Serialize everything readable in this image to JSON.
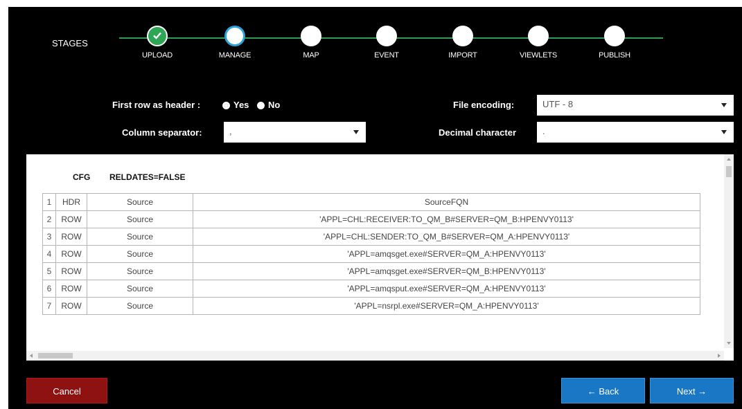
{
  "stages": {
    "label": "STAGES",
    "items": [
      {
        "name": "UPLOAD",
        "state": "done"
      },
      {
        "name": "MANAGE",
        "state": "active"
      },
      {
        "name": "MAP",
        "state": "pending"
      },
      {
        "name": "EVENT",
        "state": "pending"
      },
      {
        "name": "IMPORT",
        "state": "pending"
      },
      {
        "name": "VIEWLETS",
        "state": "pending"
      },
      {
        "name": "PUBLISH",
        "state": "pending"
      }
    ]
  },
  "options": {
    "header_label": "First row as header :",
    "header_yes": "Yes",
    "header_no": "No",
    "header_selected": "Yes",
    "encoding_label": "File encoding:",
    "encoding_value": "UTF - 8",
    "separator_label": "Column separator:",
    "separator_value": ",",
    "decimal_label": "Decimal character",
    "decimal_value": "."
  },
  "table": {
    "cfg_label": "CFG",
    "cfg_value": "RELDATES=FALSE",
    "rows": [
      {
        "num": "1",
        "type": "HDR",
        "source": "Source",
        "fqn": "SourceFQN"
      },
      {
        "num": "2",
        "type": "ROW",
        "source": "Source",
        "fqn": "'APPL=CHL:RECEIVER:TO_QM_B#SERVER=QM_B:HPENVY0113'"
      },
      {
        "num": "3",
        "type": "ROW",
        "source": "Source",
        "fqn": "'APPL=CHL:SENDER:TO_QM_B#SERVER=QM_A:HPENVY0113'"
      },
      {
        "num": "4",
        "type": "ROW",
        "source": "Source",
        "fqn": "'APPL=amqsget.exe#SERVER=QM_A:HPENVY0113'"
      },
      {
        "num": "5",
        "type": "ROW",
        "source": "Source",
        "fqn": "'APPL=amqsget.exe#SERVER=QM_B:HPENVY0113'"
      },
      {
        "num": "6",
        "type": "ROW",
        "source": "Source",
        "fqn": "'APPL=amqsput.exe#SERVER=QM_A:HPENVY0113'"
      },
      {
        "num": "7",
        "type": "ROW",
        "source": "Source",
        "fqn": "'APPL=nsrpl.exe#SERVER=QM_A:HPENVY0113'"
      }
    ]
  },
  "buttons": {
    "cancel": "Cancel",
    "back": "← Back",
    "next": "Next →"
  },
  "colors": {
    "background": "#000000",
    "stage_line": "#2e9e52",
    "stage_done": "#2ea656",
    "stage_active_ring": "#2aa3d6",
    "cancel": "#8e1212",
    "primary": "#1a77c6"
  }
}
